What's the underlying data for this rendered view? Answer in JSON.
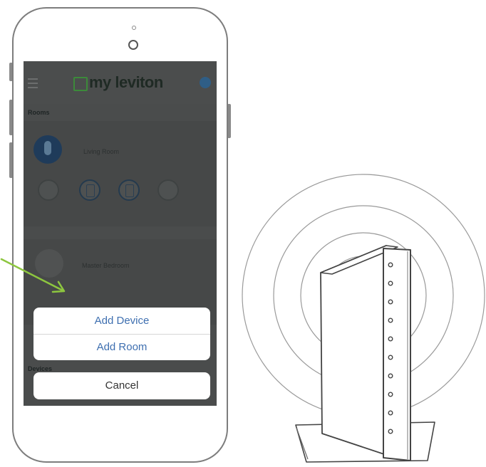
{
  "app": {
    "logo_text": "my leviton",
    "accent_color": "#3c8a3a",
    "header_icons": [
      "hamburger-menu-icon",
      "settings-icon"
    ]
  },
  "rooms": {
    "section_label": "Rooms",
    "items": [
      {
        "name": "Living Room",
        "icon": "room-icon"
      },
      {
        "name": "Master Bedroom",
        "icon": "room-icon"
      }
    ]
  },
  "devices": {
    "section_label": "Devices"
  },
  "action_sheet": {
    "add_device": "Add Device",
    "add_room": "Add Room",
    "cancel": "Cancel",
    "button_color": "#3e6fb0"
  },
  "illustration": {
    "router_icon": "wifi-router-icon",
    "arrow_color": "#8dc63f"
  }
}
